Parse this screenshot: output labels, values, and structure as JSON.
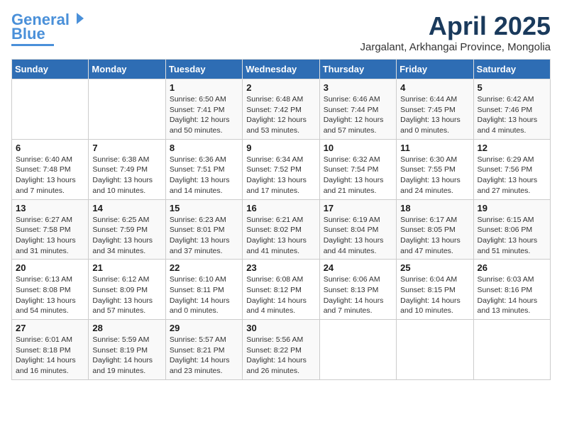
{
  "logo": {
    "line1": "General",
    "line2": "Blue"
  },
  "title": "April 2025",
  "location": "Jargalant, Arkhangai Province, Mongolia",
  "headers": [
    "Sunday",
    "Monday",
    "Tuesday",
    "Wednesday",
    "Thursday",
    "Friday",
    "Saturday"
  ],
  "weeks": [
    [
      {
        "day": "",
        "info": ""
      },
      {
        "day": "",
        "info": ""
      },
      {
        "day": "1",
        "info": "Sunrise: 6:50 AM\nSunset: 7:41 PM\nDaylight: 12 hours\nand 50 minutes."
      },
      {
        "day": "2",
        "info": "Sunrise: 6:48 AM\nSunset: 7:42 PM\nDaylight: 12 hours\nand 53 minutes."
      },
      {
        "day": "3",
        "info": "Sunrise: 6:46 AM\nSunset: 7:44 PM\nDaylight: 12 hours\nand 57 minutes."
      },
      {
        "day": "4",
        "info": "Sunrise: 6:44 AM\nSunset: 7:45 PM\nDaylight: 13 hours\nand 0 minutes."
      },
      {
        "day": "5",
        "info": "Sunrise: 6:42 AM\nSunset: 7:46 PM\nDaylight: 13 hours\nand 4 minutes."
      }
    ],
    [
      {
        "day": "6",
        "info": "Sunrise: 6:40 AM\nSunset: 7:48 PM\nDaylight: 13 hours\nand 7 minutes."
      },
      {
        "day": "7",
        "info": "Sunrise: 6:38 AM\nSunset: 7:49 PM\nDaylight: 13 hours\nand 10 minutes."
      },
      {
        "day": "8",
        "info": "Sunrise: 6:36 AM\nSunset: 7:51 PM\nDaylight: 13 hours\nand 14 minutes."
      },
      {
        "day": "9",
        "info": "Sunrise: 6:34 AM\nSunset: 7:52 PM\nDaylight: 13 hours\nand 17 minutes."
      },
      {
        "day": "10",
        "info": "Sunrise: 6:32 AM\nSunset: 7:54 PM\nDaylight: 13 hours\nand 21 minutes."
      },
      {
        "day": "11",
        "info": "Sunrise: 6:30 AM\nSunset: 7:55 PM\nDaylight: 13 hours\nand 24 minutes."
      },
      {
        "day": "12",
        "info": "Sunrise: 6:29 AM\nSunset: 7:56 PM\nDaylight: 13 hours\nand 27 minutes."
      }
    ],
    [
      {
        "day": "13",
        "info": "Sunrise: 6:27 AM\nSunset: 7:58 PM\nDaylight: 13 hours\nand 31 minutes."
      },
      {
        "day": "14",
        "info": "Sunrise: 6:25 AM\nSunset: 7:59 PM\nDaylight: 13 hours\nand 34 minutes."
      },
      {
        "day": "15",
        "info": "Sunrise: 6:23 AM\nSunset: 8:01 PM\nDaylight: 13 hours\nand 37 minutes."
      },
      {
        "day": "16",
        "info": "Sunrise: 6:21 AM\nSunset: 8:02 PM\nDaylight: 13 hours\nand 41 minutes."
      },
      {
        "day": "17",
        "info": "Sunrise: 6:19 AM\nSunset: 8:04 PM\nDaylight: 13 hours\nand 44 minutes."
      },
      {
        "day": "18",
        "info": "Sunrise: 6:17 AM\nSunset: 8:05 PM\nDaylight: 13 hours\nand 47 minutes."
      },
      {
        "day": "19",
        "info": "Sunrise: 6:15 AM\nSunset: 8:06 PM\nDaylight: 13 hours\nand 51 minutes."
      }
    ],
    [
      {
        "day": "20",
        "info": "Sunrise: 6:13 AM\nSunset: 8:08 PM\nDaylight: 13 hours\nand 54 minutes."
      },
      {
        "day": "21",
        "info": "Sunrise: 6:12 AM\nSunset: 8:09 PM\nDaylight: 13 hours\nand 57 minutes."
      },
      {
        "day": "22",
        "info": "Sunrise: 6:10 AM\nSunset: 8:11 PM\nDaylight: 14 hours\nand 0 minutes."
      },
      {
        "day": "23",
        "info": "Sunrise: 6:08 AM\nSunset: 8:12 PM\nDaylight: 14 hours\nand 4 minutes."
      },
      {
        "day": "24",
        "info": "Sunrise: 6:06 AM\nSunset: 8:13 PM\nDaylight: 14 hours\nand 7 minutes."
      },
      {
        "day": "25",
        "info": "Sunrise: 6:04 AM\nSunset: 8:15 PM\nDaylight: 14 hours\nand 10 minutes."
      },
      {
        "day": "26",
        "info": "Sunrise: 6:03 AM\nSunset: 8:16 PM\nDaylight: 14 hours\nand 13 minutes."
      }
    ],
    [
      {
        "day": "27",
        "info": "Sunrise: 6:01 AM\nSunset: 8:18 PM\nDaylight: 14 hours\nand 16 minutes."
      },
      {
        "day": "28",
        "info": "Sunrise: 5:59 AM\nSunset: 8:19 PM\nDaylight: 14 hours\nand 19 minutes."
      },
      {
        "day": "29",
        "info": "Sunrise: 5:57 AM\nSunset: 8:21 PM\nDaylight: 14 hours\nand 23 minutes."
      },
      {
        "day": "30",
        "info": "Sunrise: 5:56 AM\nSunset: 8:22 PM\nDaylight: 14 hours\nand 26 minutes."
      },
      {
        "day": "",
        "info": ""
      },
      {
        "day": "",
        "info": ""
      },
      {
        "day": "",
        "info": ""
      }
    ]
  ]
}
